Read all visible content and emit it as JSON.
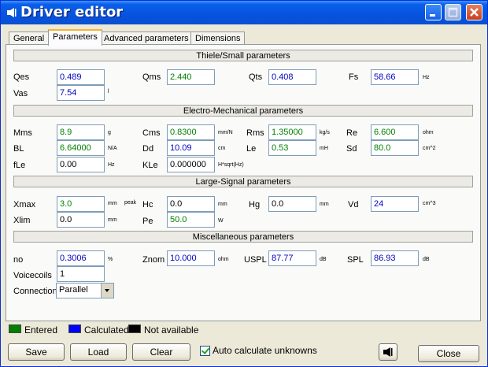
{
  "window": {
    "title": "Driver editor",
    "icon": "speaker-icon"
  },
  "tabs": [
    {
      "label": "General"
    },
    {
      "label": "Parameters"
    },
    {
      "label": "Advanced parameters"
    },
    {
      "label": "Dimensions"
    }
  ],
  "sections": {
    "ts": "Thiele/Small parameters",
    "em": "Electro-Mechanical parameters",
    "ls": "Large-Signal parameters",
    "misc": "Miscellaneous parameters"
  },
  "params": {
    "qes": {
      "label": "Qes",
      "value": "0.489",
      "status": "calculated",
      "unit": ""
    },
    "qms": {
      "label": "Qms",
      "value": "2.440",
      "status": "entered",
      "unit": ""
    },
    "qts": {
      "label": "Qts",
      "value": "0.408",
      "status": "calculated",
      "unit": ""
    },
    "fs": {
      "label": "Fs",
      "value": "58.66",
      "status": "calculated",
      "unit": "Hz"
    },
    "vas": {
      "label": "Vas",
      "value": "7.54",
      "status": "calculated",
      "unit": "l"
    },
    "mms": {
      "label": "Mms",
      "value": "8.9",
      "status": "entered",
      "unit": "g"
    },
    "cms": {
      "label": "Cms",
      "value": "0.8300",
      "status": "entered",
      "unit": "mm/N"
    },
    "rms": {
      "label": "Rms",
      "value": "1.35000",
      "status": "entered",
      "unit": "kg/s"
    },
    "re": {
      "label": "Re",
      "value": "6.600",
      "status": "entered",
      "unit": "ohm"
    },
    "bl": {
      "label": "BL",
      "value": "6.64000",
      "status": "entered",
      "unit": "N/A"
    },
    "dd": {
      "label": "Dd",
      "value": "10.09",
      "status": "calculated",
      "unit": "cm"
    },
    "le": {
      "label": "Le",
      "value": "0.53",
      "status": "entered",
      "unit": "mH"
    },
    "sd": {
      "label": "Sd",
      "value": "80.0",
      "status": "entered",
      "unit": "cm^2"
    },
    "fle": {
      "label": "fLe",
      "value": "0.00",
      "status": "na",
      "unit": "Hz"
    },
    "kle": {
      "label": "KLe",
      "value": "0.000000",
      "status": "na",
      "unit": "H*sqrt(Hz)"
    },
    "xmax": {
      "label": "Xmax",
      "value": "3.0",
      "status": "entered",
      "unit": "mm",
      "unit2": "peak"
    },
    "hc": {
      "label": "Hc",
      "value": "0.0",
      "status": "na",
      "unit": "mm"
    },
    "hg": {
      "label": "Hg",
      "value": "0.0",
      "status": "na",
      "unit": "mm"
    },
    "vd": {
      "label": "Vd",
      "value": "24",
      "status": "calculated",
      "unit": "cm^3"
    },
    "xlim": {
      "label": "Xlim",
      "value": "0.0",
      "status": "na",
      "unit": "mm"
    },
    "pe": {
      "label": "Pe",
      "value": "50.0",
      "status": "entered",
      "unit": "W"
    },
    "no": {
      "label": "no",
      "value": "0.3006",
      "status": "calculated",
      "unit": "%"
    },
    "znom": {
      "label": "Znom",
      "value": "10.000",
      "status": "calculated",
      "unit": "ohm"
    },
    "uspl": {
      "label": "USPL",
      "value": "87.77",
      "status": "calculated",
      "unit": "dB"
    },
    "spl": {
      "label": "SPL",
      "value": "86.93",
      "status": "calculated",
      "unit": "dB"
    },
    "voicecoils": {
      "label": "Voicecoils",
      "value": "1",
      "status": "na"
    },
    "connection": {
      "label": "Connection",
      "value": "Parallel"
    }
  },
  "legend": [
    {
      "label": "Entered",
      "color": "#008000"
    },
    {
      "label": "Calculated",
      "color": "#0000ff"
    },
    {
      "label": "Not available",
      "color": "#000000"
    }
  ],
  "buttons": {
    "save": "Save",
    "load": "Load",
    "clear": "Clear",
    "auto_calc": "Auto calculate unknowns",
    "auto_calc_checked": true,
    "close": "Close"
  }
}
